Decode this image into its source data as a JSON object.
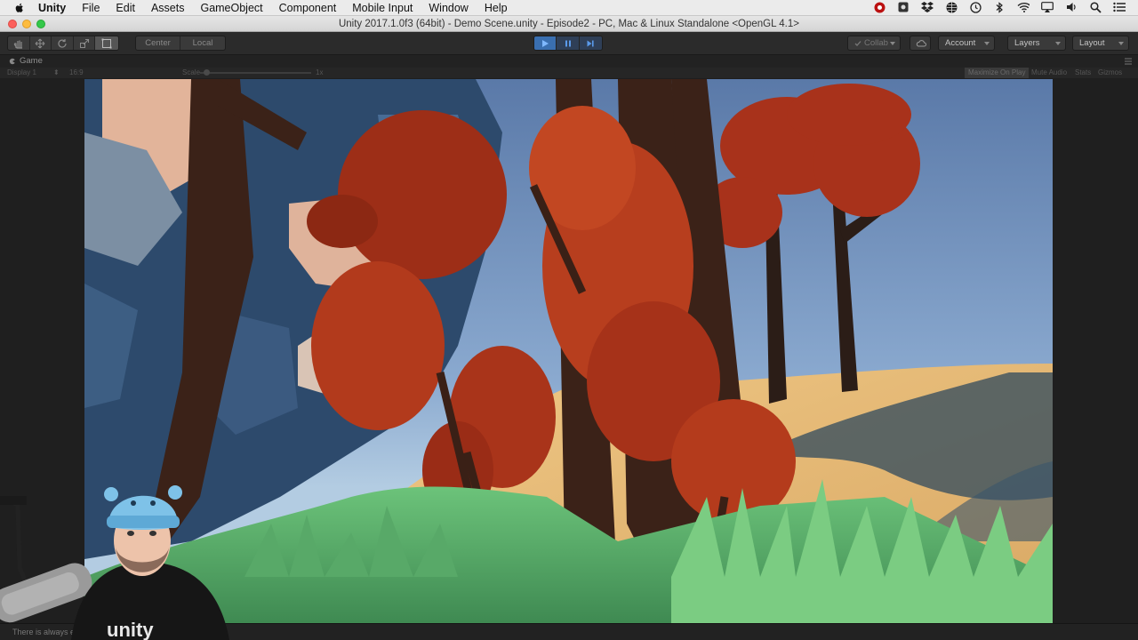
{
  "menubar": {
    "app_name": "Unity",
    "items": [
      "File",
      "Edit",
      "Assets",
      "GameObject",
      "Component",
      "Mobile Input",
      "Window",
      "Help"
    ],
    "status_icons": [
      "record-icon",
      "screen-capture-icon",
      "dropbox-icon",
      "globe-icon",
      "time-machine-icon",
      "bluetooth-icon",
      "wifi-icon",
      "airplay-icon",
      "volume-icon",
      "spotlight-icon",
      "notification-center-icon"
    ]
  },
  "window": {
    "title": "Unity 2017.1.0f3 (64bit) - Demo Scene.unity - Episode2 - PC, Mac & Linux Standalone <OpenGL 4.1>"
  },
  "toolbar": {
    "transform_tools": [
      "hand-tool-icon",
      "move-tool-icon",
      "rotate-tool-icon",
      "scale-tool-icon",
      "rect-tool-icon"
    ],
    "pivot_label": "Center",
    "space_label": "Local",
    "play_controls": [
      "play-icon",
      "pause-icon",
      "step-icon"
    ],
    "collab_label": "Collab",
    "account_label": "Account",
    "layers_label": "Layers",
    "layout_label": "Layout"
  },
  "game_view": {
    "tab_label": "Game",
    "display_label": "Display 1",
    "aspect_label": "16:9",
    "scale_label": "Scale",
    "scale_value": "1x",
    "maximize_label": "Maximize On Play",
    "mute_label": "Mute Audio",
    "stats_label": "Stats",
    "gizmos_label": "Gizmos"
  },
  "status": {
    "message": "There is always exactly one audio listener in the scene."
  },
  "webcam": {
    "shirt_text": "unity"
  },
  "colors": {
    "play_active": "#3a6fb0",
    "editor_dark": "#2b2b2b",
    "leaves": "#b43a1c",
    "sand": "#e6b56e",
    "grass": "#5fb36a",
    "sky": "#7a9cc4"
  }
}
